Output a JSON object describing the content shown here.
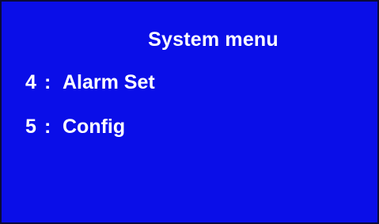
{
  "screen": {
    "title": "System menu",
    "background_color": "#0a0ee8",
    "text_color": "#ffffff",
    "menu_items": [
      {
        "number": "4",
        "separator": ":",
        "label": "Alarm Set"
      },
      {
        "number": "5",
        "separator": ":",
        "label": "Config"
      }
    ]
  }
}
